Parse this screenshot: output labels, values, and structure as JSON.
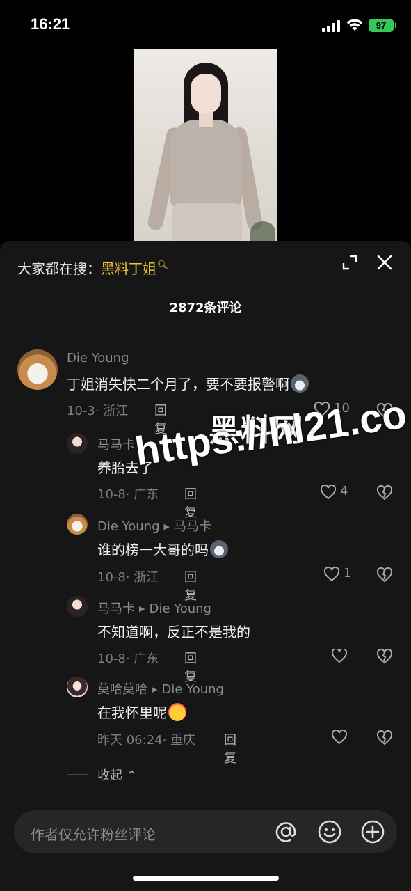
{
  "status": {
    "time": "16:21",
    "battery": "97"
  },
  "panel": {
    "search_prefix": "大家都在搜：",
    "search_keyword": "黑料丁姐",
    "comment_count": "2872条评论"
  },
  "comments": [
    {
      "name": "Die Young",
      "text": "丁姐消失快二个月了，要不要报警啊",
      "date": "10-3",
      "location": "· 浙江",
      "reply": "回复",
      "likes": "10"
    },
    {
      "name": "马马卡",
      "text": "养胎去了",
      "date": "10-8",
      "location": "· 广东",
      "reply": "回复",
      "likes": "4"
    },
    {
      "name": "Die Young",
      "reply_to": "马马卡",
      "text": "谁的榜一大哥的吗",
      "date": "10-8",
      "location": "· 浙江",
      "reply": "回复",
      "likes": "1"
    },
    {
      "name": "马马卡",
      "reply_to": "Die Young",
      "text": "不知道啊，反正不是我的",
      "date": "10-8",
      "location": "· 广东",
      "reply": "回复",
      "likes": ""
    },
    {
      "name": "莫哈莫哈",
      "reply_to": "Die Young",
      "text": "在我怀里呢",
      "date": "昨天 06:24",
      "location": "· 重庆",
      "reply": "回复",
      "likes": ""
    }
  ],
  "collapse_label": "收起",
  "watermark": {
    "line1": "黑料网",
    "line2": "https://hl21.co"
  },
  "input": {
    "placeholder": "作者仅允许粉丝评论"
  },
  "icons": [
    "signal-icon",
    "wifi-icon",
    "expand-icon",
    "close-icon",
    "search-icon",
    "like-icon",
    "dislike-icon",
    "at-icon",
    "smile-icon",
    "plus-icon"
  ]
}
